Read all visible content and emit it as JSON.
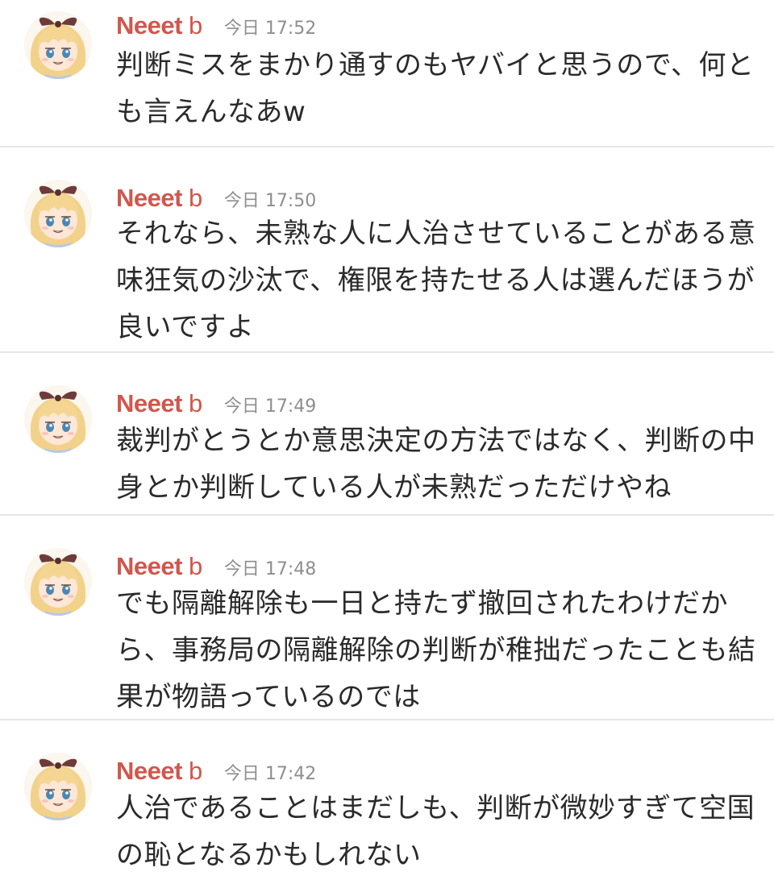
{
  "messages": [
    {
      "username": "Neeet",
      "username_suffix": " b",
      "timestamp": "今日 17:52",
      "text": "判断ミスをまかり通すのもヤバイと思うので、何とも言えんなあw"
    },
    {
      "username": "Neeet",
      "username_suffix": " b",
      "timestamp": "今日 17:50",
      "text": "それなら、未熟な人に人治させていることがある意味狂気の沙汰で、権限を持たせる人は選んだほうが良いですよ"
    },
    {
      "username": "Neeet",
      "username_suffix": " b",
      "timestamp": "今日 17:49",
      "text": "裁判がとうとか意思決定の方法ではなく、判断の中身とか判断している人が未熟だっただけやね"
    },
    {
      "username": "Neeet",
      "username_suffix": " b",
      "timestamp": "今日 17:48",
      "text": "でも隔離解除も一日と持たず撤回されたわけだから、事務局の隔離解除の判断が稚拙だったことも結果が物語っているのでは"
    },
    {
      "username": "Neeet",
      "username_suffix": " b",
      "timestamp": "今日 17:42",
      "text": "人治であることはまだしも、判断が微妙すぎて空国の恥となるかもしれない"
    }
  ],
  "colors": {
    "username": "#d0574c",
    "timestamp": "#8e8e8e",
    "text": "#2a2a2a",
    "divider": "#e6e6e6"
  },
  "icons": {
    "avatar": "anime-girl-avatar-icon"
  }
}
